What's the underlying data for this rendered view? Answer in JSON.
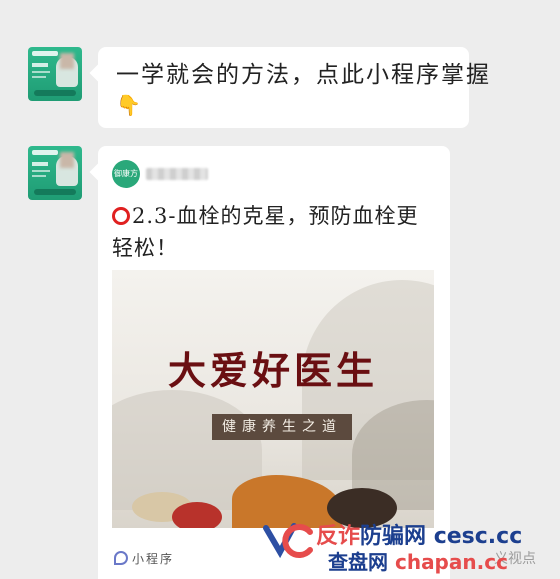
{
  "messages": [
    {
      "text": "一学就会的方法，点此小程序掌握",
      "emoji": "👇"
    }
  ],
  "card": {
    "source_logo_text": "御康方",
    "title_marker": "⭕",
    "title": "2.3-血栓的克星，预防血栓更轻松！",
    "poster": {
      "title": "大爱好医生",
      "subtitle": "健康养生之道"
    },
    "footer_label": "小程序"
  },
  "watermark": {
    "line1_red": "反诈",
    "line1_blue": "防骗网",
    "line1_url": "cesc.cc",
    "line2_blue": "查盘网",
    "line2_url": "chapan.cc",
    "faded_text": "义视点"
  }
}
